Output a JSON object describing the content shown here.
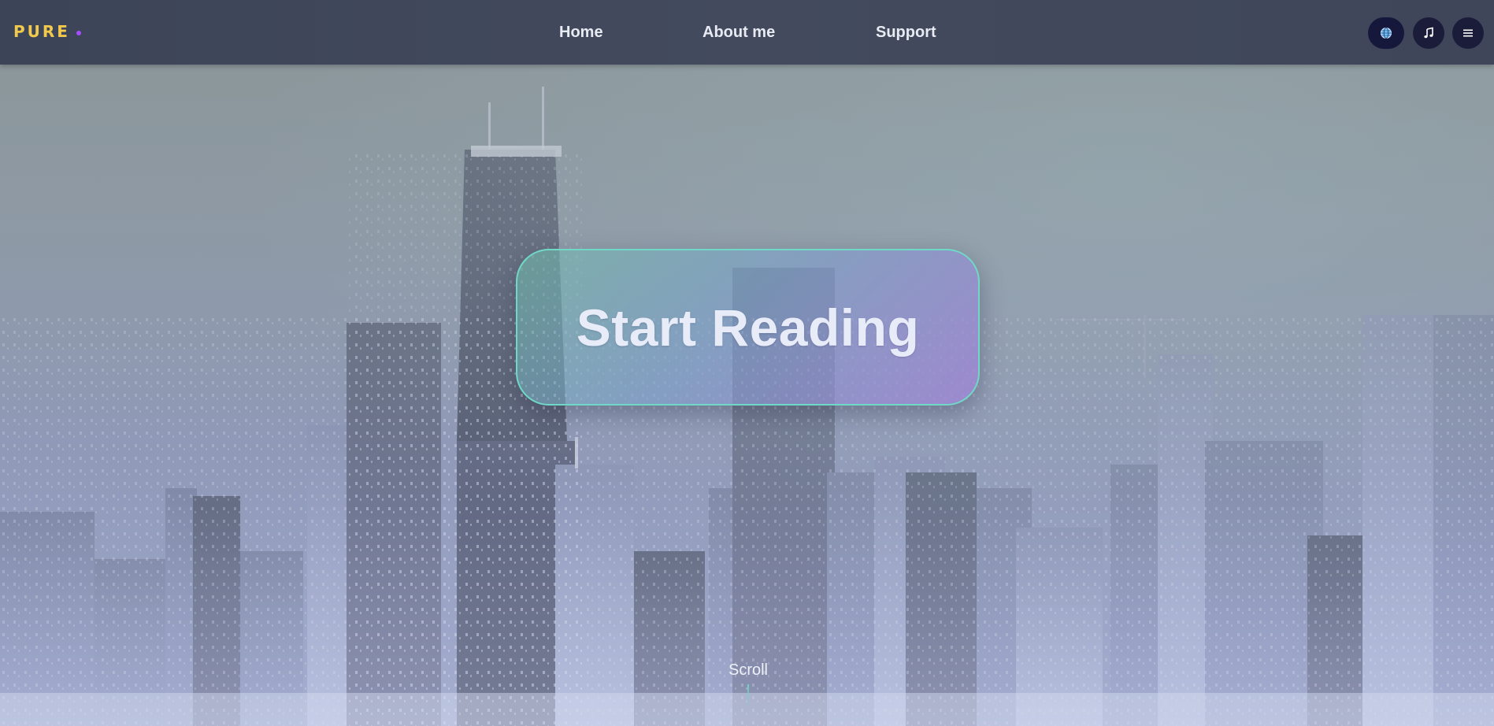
{
  "brand": {
    "name": "PURE",
    "color": "#f2c94c",
    "dot_color": "#a64dff"
  },
  "nav": {
    "links": [
      {
        "label": "Home"
      },
      {
        "label": "About me"
      },
      {
        "label": "Support"
      }
    ]
  },
  "header_actions": [
    {
      "icon": "globe-icon"
    },
    {
      "icon": "music-note-icon"
    },
    {
      "icon": "hamburger-menu-icon"
    }
  ],
  "hero": {
    "cta_label": "Start Reading",
    "scroll_label": "Scroll",
    "accent_color": "#6fd8c6",
    "background": "city skyline photo"
  }
}
